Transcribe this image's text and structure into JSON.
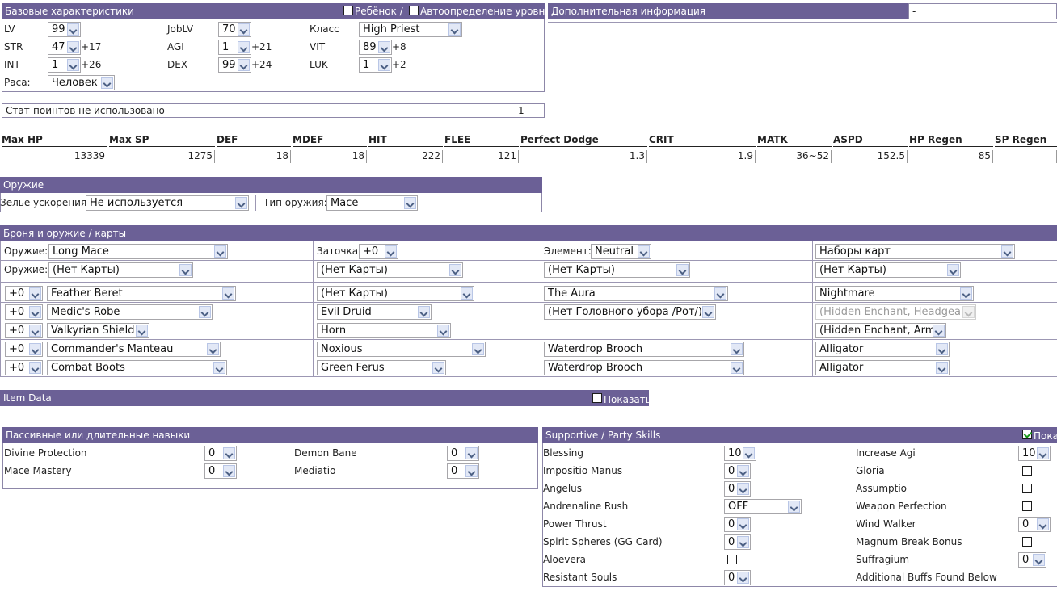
{
  "basic": {
    "title": "Базовые характеристики",
    "child_label": "Ребёнок /",
    "auto_label": "Автоопределение уровня",
    "lv_label": "LV",
    "lv": "99",
    "joblv_label": "JobLV",
    "joblv": "70",
    "class_label": "Класс",
    "class": "High Priest",
    "str_label": "STR",
    "str": "47",
    "str_bonus": "+17",
    "agi_label": "AGI",
    "agi": "1",
    "agi_bonus": "+21",
    "vit_label": "VIT",
    "vit": "89",
    "vit_bonus": "+8",
    "int_label": "INT",
    "int": "1",
    "int_bonus": "+26",
    "dex_label": "DEX",
    "dex": "99",
    "dex_bonus": "+24",
    "luk_label": "LUK",
    "luk": "1",
    "luk_bonus": "+2",
    "race_label": "Раса:",
    "race": "Человек"
  },
  "extra": {
    "title": "Дополнительная информация",
    "value": "-"
  },
  "statpoints": {
    "label": "Стат-поинтов не использовано",
    "value": "1"
  },
  "stats": {
    "headers": [
      "Max HP",
      "Max SP",
      "DEF",
      "MDEF",
      "HIT",
      "FLEE",
      "Perfect Dodge",
      "CRIT",
      "MATK",
      "ASPD",
      "HP Regen",
      "SP Regen"
    ],
    "values": [
      "13339",
      "1275",
      "18",
      "18",
      "222",
      "121",
      "1.3",
      "1.9",
      "36~52",
      "152.5",
      "85",
      ""
    ]
  },
  "weapon": {
    "title": "Оружие",
    "potion_label": "Зелье ускорения:",
    "potion": "Не используется",
    "type_label": "Тип оружия:",
    "type": "Mace"
  },
  "armor": {
    "title": "Броня и оружие / карты",
    "weapon_label": "Оружие:",
    "weapon": "Long Mace",
    "refine_label": "Заточка:",
    "refine": "+0",
    "element_label": "Элемент:",
    "element": "Neutral",
    "cardsets": "Наборы карт",
    "cards_label": "Оружие:",
    "cards": [
      "(Нет Карты)",
      "(Нет Карты)",
      "(Нет Карты)",
      "(Нет Карты)"
    ],
    "rows": [
      {
        "refine": "+0",
        "item": "Feather Beret",
        "card": "(Нет Карты)",
        "c3": "The Aura",
        "c4": "Nightmare"
      },
      {
        "refine": "+0",
        "item": "Medic's Robe",
        "card": "Evil Druid",
        "c3": "(Нет Головного убора /Рот/)",
        "c4": "(Hidden Enchant, Headgear)"
      },
      {
        "refine": "+0",
        "item": "Valkyrian Shield",
        "card": "Horn",
        "c3": "",
        "c4": "(Hidden Enchant, Armor)"
      },
      {
        "refine": "+0",
        "item": "Commander's Manteau",
        "card": "Noxious",
        "c3": "Waterdrop Brooch",
        "c4": "Alligator"
      },
      {
        "refine": "+0",
        "item": "Combat Boots",
        "card": "Green Ferus",
        "c3": "Waterdrop Brooch",
        "c4": "Alligator"
      }
    ]
  },
  "itemdata": {
    "title": "Item Data",
    "show_label": "Показать"
  },
  "passive": {
    "title": "Пассивные или длительные навыки",
    "skills": [
      {
        "name": "Divine Protection",
        "value": "0"
      },
      {
        "name": "Demon Bane",
        "value": "0"
      },
      {
        "name": "Mace Mastery",
        "value": "0"
      },
      {
        "name": "Mediatio",
        "value": "0"
      }
    ]
  },
  "support": {
    "title": "Supportive / Party Skills",
    "show_label": "Показ",
    "left": [
      {
        "name": "Blessing",
        "value": "10"
      },
      {
        "name": "Impositio Manus",
        "value": "0"
      },
      {
        "name": "Angelus",
        "value": "0"
      },
      {
        "name": "Andrenaline Rush",
        "value": "OFF"
      },
      {
        "name": "Power Thrust",
        "value": "0"
      },
      {
        "name": "Spirit Spheres (GG Card)",
        "value": "0"
      },
      {
        "name": "Aloevera",
        "value": ""
      },
      {
        "name": "Resistant Souls",
        "value": "0"
      }
    ],
    "right": [
      {
        "name": "Increase Agi",
        "value": "10"
      },
      {
        "name": "Gloria",
        "value": ""
      },
      {
        "name": "Assumptio",
        "value": ""
      },
      {
        "name": "Weapon Perfection",
        "value": ""
      },
      {
        "name": "Wind Walker",
        "value": "0"
      },
      {
        "name": "Magnum Break Bonus",
        "value": ""
      },
      {
        "name": "Suffragium",
        "value": "0"
      },
      {
        "name": "Additional Buffs Found Below",
        "value": ""
      }
    ]
  },
  "colors": {
    "header_bg": "#6b6096",
    "border": "#8d87a8"
  }
}
